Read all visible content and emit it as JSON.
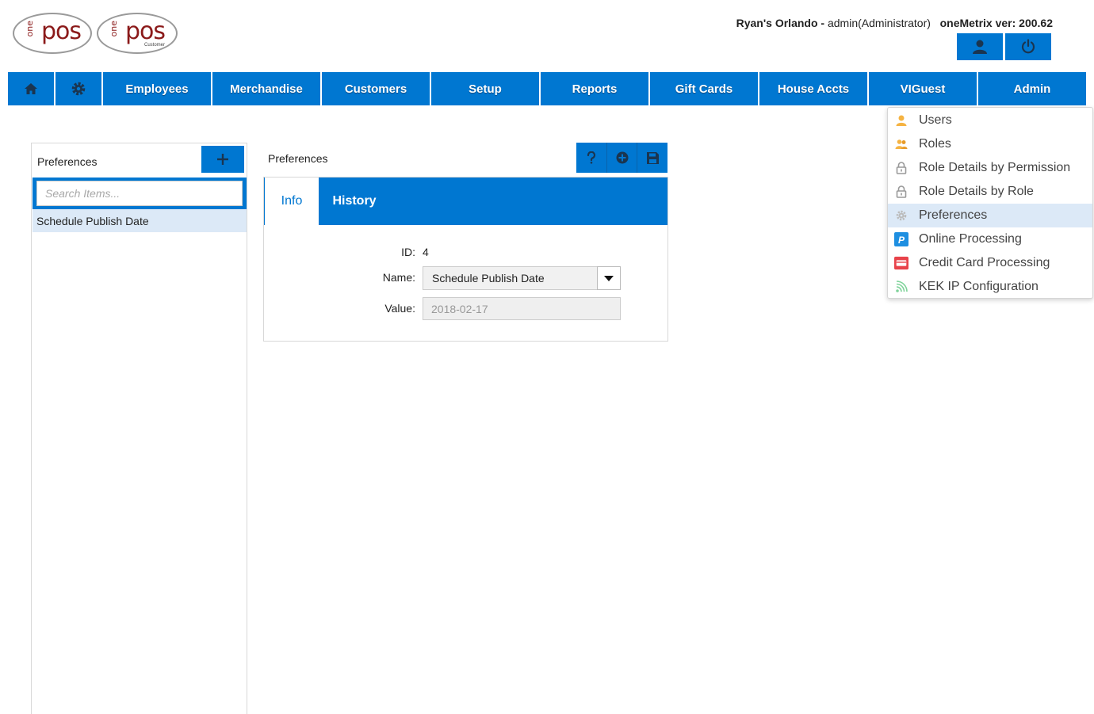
{
  "logos": [
    {
      "one": "one",
      "pos": "pos",
      "sub": ""
    },
    {
      "one": "one",
      "pos": "pos",
      "sub": "Customer"
    }
  ],
  "header": {
    "store": "Ryan's Orlando",
    "separator": " - ",
    "user": "admin(Administrator)",
    "version": "oneMetrix ver: 200.62"
  },
  "nav": {
    "items": [
      "Employees",
      "Merchandise",
      "Customers",
      "Setup",
      "Reports",
      "Gift Cards",
      "House Accts",
      "VIGuest",
      "Admin"
    ]
  },
  "admin_menu": {
    "items": [
      {
        "label": "Users",
        "icon": "user-icon"
      },
      {
        "label": "Roles",
        "icon": "users-icon"
      },
      {
        "label": "Role Details by Permission",
        "icon": "lock-icon"
      },
      {
        "label": "Role Details by Role",
        "icon": "lock-icon"
      },
      {
        "label": "Preferences",
        "icon": "gear-icon"
      },
      {
        "label": "Online Processing",
        "icon": "paypal-icon"
      },
      {
        "label": "Credit Card Processing",
        "icon": "credit-card-icon"
      },
      {
        "label": "KEK IP Configuration",
        "icon": "wifi-icon"
      }
    ],
    "active_index": 4
  },
  "list_panel": {
    "title": "Preferences",
    "search_placeholder": "Search Items...",
    "items": [
      "Schedule Publish Date"
    ]
  },
  "detail": {
    "title": "Preferences",
    "tabs": [
      "Info",
      "History"
    ],
    "fields": {
      "id_label": "ID:",
      "id_value": "4",
      "name_label": "Name:",
      "name_value": "Schedule Publish Date",
      "value_label": "Value:",
      "value_value": "2018-02-17"
    }
  },
  "colors": {
    "primary": "#0077d1",
    "selected_row": "#dce9f7",
    "logo_red": "#8b1a1a"
  }
}
